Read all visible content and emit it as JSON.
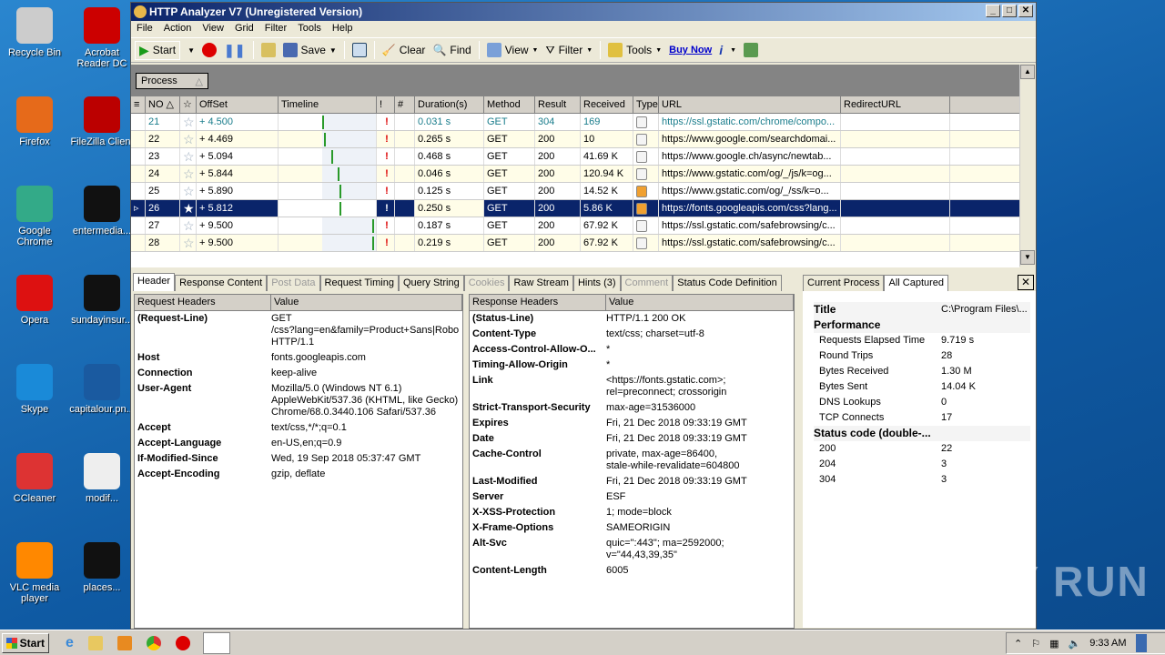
{
  "desktop": {
    "icons": [
      "Recycle Bin",
      "Acrobat Reader DC",
      "Firefox",
      "FileZilla Client",
      "Google Chrome",
      "entermedia...",
      "Opera",
      "sundayinsur...",
      "Skype",
      "capitalour.pn...",
      "CCleaner",
      "modif...",
      "VLC media player",
      "places..."
    ]
  },
  "window": {
    "title": "HTTP Analyzer V7  (Unregistered Version)"
  },
  "menu": [
    "File",
    "Action",
    "View",
    "Grid",
    "Filter",
    "Tools",
    "Help"
  ],
  "toolbar": {
    "start": "Start",
    "save": "Save",
    "clear": "Clear",
    "find": "Find",
    "view": "View",
    "filter": "Filter",
    "tools": "Tools",
    "buy_now": "Buy Now"
  },
  "group_by": "Process",
  "grid": {
    "columns": [
      "NO",
      "",
      "OffSet",
      "Timeline",
      "!",
      "#",
      "Duration(s)",
      "Method",
      "Result",
      "Received",
      "Type",
      "URL",
      "RedirectURL"
    ],
    "rows": [
      {
        "no": "21",
        "offset": "+ 4.500",
        "duration": "0.031 s",
        "method": "GET",
        "result": "304",
        "received": "169",
        "url": "https://ssl.gstatic.com/chrome/compo...",
        "tl": 0.2,
        "color": "#1a7d8c"
      },
      {
        "no": "22",
        "offset": "+ 4.469",
        "duration": "0.265 s",
        "method": "GET",
        "result": "200",
        "received": "10",
        "url": "https://www.google.com/searchdomai...",
        "tl": 0.21
      },
      {
        "no": "23",
        "offset": "+ 5.094",
        "duration": "0.468 s",
        "method": "GET",
        "result": "200",
        "received": "41.69 K",
        "url": "https://www.google.ch/async/newtab...",
        "tl": 0.24
      },
      {
        "no": "24",
        "offset": "+ 5.844",
        "duration": "0.046 s",
        "method": "GET",
        "result": "200",
        "received": "120.94 K",
        "url": "https://www.gstatic.com/og/_/js/k=og...",
        "tl": 0.27
      },
      {
        "no": "25",
        "offset": "+ 5.890",
        "duration": "0.125 s",
        "method": "GET",
        "result": "200",
        "received": "14.52 K",
        "url": "https://www.gstatic.com/og/_/ss/k=o...",
        "tl": 0.28
      },
      {
        "no": "26",
        "offset": "+ 5.812",
        "duration": "0.250 s",
        "method": "GET",
        "result": "200",
        "received": "5.86 K",
        "url": "https://fonts.googleapis.com/css?lang...",
        "tl": 0.28,
        "selected": true
      },
      {
        "no": "27",
        "offset": "+ 9.500",
        "duration": "0.187 s",
        "method": "GET",
        "result": "200",
        "received": "67.92 K",
        "url": "https://ssl.gstatic.com/safebrowsing/c...",
        "tl": 0.43
      },
      {
        "no": "28",
        "offset": "+ 9.500",
        "duration": "0.219 s",
        "method": "GET",
        "result": "200",
        "received": "67.92 K",
        "url": "https://ssl.gstatic.com/safebrowsing/c...",
        "tl": 0.43
      }
    ]
  },
  "tabs": [
    {
      "label": "Header",
      "active": true
    },
    {
      "label": "Response Content"
    },
    {
      "label": "Post Data",
      "disabled": true
    },
    {
      "label": "Request Timing"
    },
    {
      "label": "Query String"
    },
    {
      "label": "Cookies",
      "disabled": true
    },
    {
      "label": "Raw Stream"
    },
    {
      "label": "Hints (3)"
    },
    {
      "label": "Comment",
      "disabled": true
    },
    {
      "label": "Status Code Definition"
    }
  ],
  "request": {
    "col1": "Request Headers",
    "col2": "Value",
    "rows": [
      [
        "(Request-Line)",
        "GET\n/css?lang=en&family=Product+Sans|Robo\nHTTP/1.1"
      ],
      [
        "Host",
        "fonts.googleapis.com"
      ],
      [
        "Connection",
        "keep-alive"
      ],
      [
        "User-Agent",
        "Mozilla/5.0 (Windows NT 6.1)\nAppleWebKit/537.36 (KHTML, like Gecko)\nChrome/68.0.3440.106 Safari/537.36"
      ],
      [
        "Accept",
        "text/css,*/*;q=0.1"
      ],
      [
        "Accept-Language",
        "en-US,en;q=0.9"
      ],
      [
        "If-Modified-Since",
        "Wed, 19 Sep 2018 05:37:47 GMT"
      ],
      [
        "Accept-Encoding",
        "gzip, deflate"
      ]
    ]
  },
  "response": {
    "col1": "Response Headers",
    "col2": "Value",
    "rows": [
      [
        "(Status-Line)",
        "HTTP/1.1 200 OK"
      ],
      [
        "Content-Type",
        "text/css; charset=utf-8"
      ],
      [
        "Access-Control-Allow-O...",
        "*"
      ],
      [
        "Timing-Allow-Origin",
        "*"
      ],
      [
        "Link",
        "<https://fonts.gstatic.com>;\nrel=preconnect; crossorigin"
      ],
      [
        "Strict-Transport-Security",
        "max-age=31536000"
      ],
      [
        "Expires",
        "Fri, 21 Dec 2018 09:33:19 GMT"
      ],
      [
        "Date",
        "Fri, 21 Dec 2018 09:33:19 GMT"
      ],
      [
        "Cache-Control",
        "private, max-age=86400,\nstale-while-revalidate=604800"
      ],
      [
        "Last-Modified",
        "Fri, 21 Dec 2018 09:33:19 GMT"
      ],
      [
        "Server",
        "ESF"
      ],
      [
        "X-XSS-Protection",
        "1; mode=block"
      ],
      [
        "X-Frame-Options",
        "SAMEORIGIN"
      ],
      [
        "Alt-Svc",
        "quic=\":443\"; ma=2592000;\nv=\"44,43,39,35\""
      ],
      [
        "Content-Length",
        "6005"
      ]
    ]
  },
  "process_panel": {
    "tabs": [
      "Current Process",
      "All Captured"
    ],
    "rows": [
      {
        "k": "Title",
        "v": "C:\\Program Files\\...",
        "bold": true
      },
      {
        "k": "Performance",
        "v": "",
        "bold": true
      },
      {
        "k": "Requests Elapsed Time",
        "v": "9.719 s"
      },
      {
        "k": "Round Trips",
        "v": "28"
      },
      {
        "k": "Bytes Received",
        "v": "1.30 M"
      },
      {
        "k": "Bytes Sent",
        "v": "14.04 K"
      },
      {
        "k": "DNS Lookups",
        "v": "0"
      },
      {
        "k": "TCP Connects",
        "v": "17"
      },
      {
        "k": "Status code (double-...",
        "v": "",
        "bold": true
      },
      {
        "k": "200",
        "v": "22"
      },
      {
        "k": "204",
        "v": "3"
      },
      {
        "k": "304",
        "v": "3"
      }
    ]
  },
  "taskbar": {
    "start": "Start",
    "clock": "9:33 AM"
  },
  "watermark": "ANY RUN"
}
